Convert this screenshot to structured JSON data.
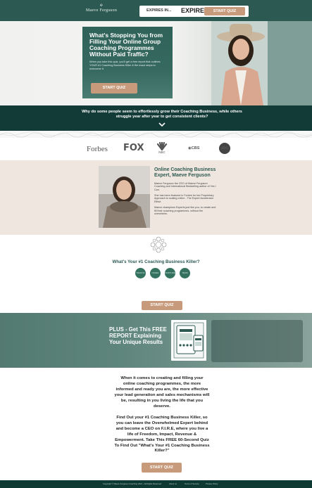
{
  "header": {
    "logo_text": "Maeve Ferguson",
    "expires_label": "EXPIRES IN...",
    "expires_value": "EXPIRED",
    "start_button": "START QUIZ"
  },
  "hero": {
    "title": "What's Stopping You from Filling Your Online Group Coaching Programmes Without Paid Traffic?",
    "description": "When you take this quiz, you'll get a free report that outlines YOUR #1 Coaching Business Killer & the exact steps to overcome it.",
    "start_button": "START QUIZ"
  },
  "band": {
    "text": "Why do some people seem to effortlessly grow their Coaching Business, while others struggle year after year to get consistent clients?"
  },
  "logos": {
    "forbes": "Forbes",
    "fox": "FOX",
    "nbc": "NBC",
    "cbs": "◉CBS",
    "abc": "abc"
  },
  "about": {
    "title": "Online Coaching Business Expert, Maeve Ferguson",
    "p1": "Maeve Ferguson the CEO of Maeve Ferguson Coaching and International Bestselling author of Yes I Can.",
    "p2": "She has been featured in Forbes for her Proprietary Approach to scaling online - The Expert Accelerator Effect",
    "p3": "Maeve champions Experts just like you, to create and fill their coaching programmes, without the overwhelm."
  },
  "quiz": {
    "title": "What's Your #1 Coaching Business Killer?",
    "options": [
      "TRAFFIC",
      "OFFER",
      "NURTURE",
      "TEAM"
    ],
    "start_button": "START QUIZ"
  },
  "plus": {
    "text": "PLUS - Get This FREE REPORT Explaining Your Unique Results"
  },
  "bottom": {
    "p1": "When it comes to creating and filling your online coaching programmes, the more informed and ready you are, the more effective your lead generation and sales mechanisms will be, resulting in you living the life that you deserve.",
    "p2": "Find Out your #1 Coaching Business Killer, so you can leave the Overwhelmed Expert behind and become a CEO on F.I.R.E, where you live a life of Freedom, Impact, Revenue & Empowerment. Take This FREE 60-Second Quiz To Find Out \"What's Your #1 Coaching Business Killer?\"",
    "start_button": "START QUIZ"
  },
  "footer": {
    "copyright": "Copyright © Maeve Ferguson Coaching 2021 - All Rights Reserved",
    "about": "About us",
    "terms": "Terms of Service",
    "privacy": "Privacy Policy"
  },
  "colors": {
    "brand_teal": "#2c5a52",
    "dark_teal": "#123a36",
    "accent_tan": "#c69a7a",
    "blush": "#efe6df"
  }
}
